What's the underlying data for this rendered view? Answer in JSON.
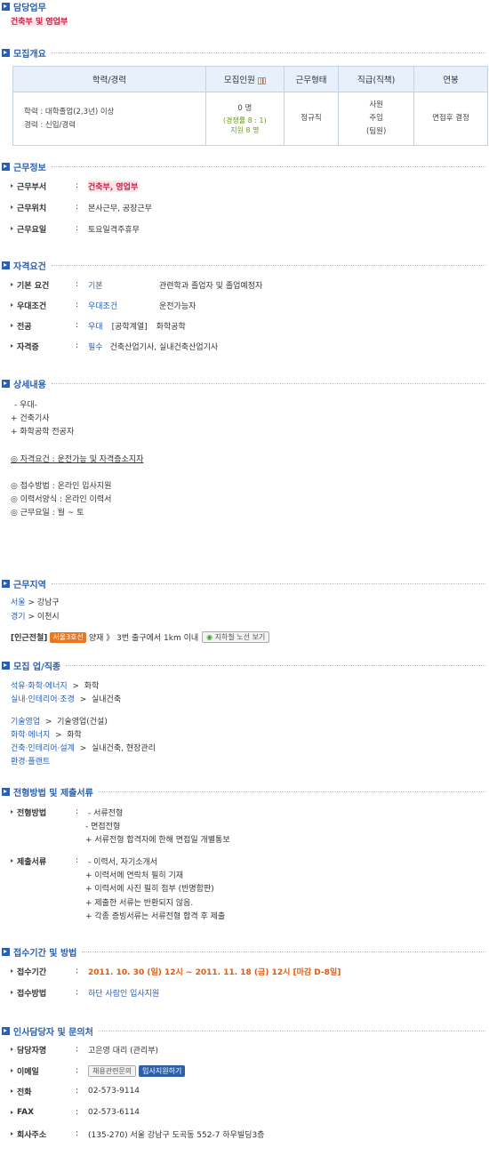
{
  "duty": {
    "title": "담당업무",
    "value": "건축부 및 영업부"
  },
  "overview": {
    "title": "모집개요",
    "headers": [
      "학력/경력",
      "모집인원",
      "근무형태",
      "직급(직책)",
      "연봉"
    ],
    "education": "학력 : 대학졸업(2,3년) 이상",
    "career": "경력 : 신입/경력",
    "headcount": "0 명",
    "competition": "(경쟁률 8 : 1)",
    "applicants": "지원 8 명",
    "work_type": "정규직",
    "rank_1": "사원",
    "rank_2": "주임",
    "rank_3": "(팀원)",
    "salary": "면접후 결정"
  },
  "work_info": {
    "title": "근무정보",
    "dept_label": "근무부서",
    "dept_value": "건축부, 영업부",
    "location_label": "근무위치",
    "location_value": "본사근무, 공장근무",
    "days_label": "근무요일",
    "days_value": "토요일격주휴무"
  },
  "qualifications": {
    "title": "자격요건",
    "basic_label": "기본 요건",
    "basic_type": "기본",
    "basic_value": "관련학과 졸업자 및 졸업예정자",
    "pref_label": "우대조건",
    "pref_type": "우대조건",
    "pref_value": "운전가능자",
    "major_label": "전공",
    "major_type": "우대",
    "major_field": "[공학계열]",
    "major_value": "화학공학",
    "cert_label": "자격증",
    "cert_type": "필수",
    "cert_value": "건축산업기사, 실내건축산업기사"
  },
  "details": {
    "title": "상세내용",
    "lines": [
      "- 우대-",
      "+ 건축기사",
      "+ 화학공학 전공자"
    ],
    "qual": "◎ 자격요건 : 운전가능 및 자격증소지자",
    "method": "◎ 접수방법 : 온라인 입사지원",
    "resume": "◎ 이력서양식 : 온라인 이력서",
    "days": "◎ 근무요일 : 월 ~ 토"
  },
  "region": {
    "title": "근무지역",
    "r1_city": "서울",
    "r1_sep": ">",
    "r1_dist": "강남구",
    "r2_city": "경기",
    "r2_sep": ">",
    "r2_dist": "이천시",
    "subway_label": "[인근전철]",
    "subway_line": "서울3호선",
    "subway_text": "양재 》 3번 출구에서 1km 이내",
    "subway_btn": "지하철 노선 보기"
  },
  "jobs": {
    "title": "모집 업/직종",
    "a1_cat": "석유·화학·에너지",
    "a1_sub": "화학",
    "a2_cat": "실내·인테리어·조경",
    "a2_sub": "실내건축",
    "b1_cat": "기술영업",
    "b1_sub": "기술영업(건설)",
    "b2_cat": "화학·에너지",
    "b2_sub": "화학",
    "b3_cat": "건축·인테리어·설계",
    "b3_sub": "실내건축, 현장관리",
    "b4_cat": "환경·플랜트",
    "sep": ">"
  },
  "process": {
    "title": "전형방법 및 제출서류",
    "method_label": "전형방법",
    "method_lines": [
      "- 서류전형",
      "- 면접전형",
      "+ 서류전형 합격자에 한해 면접일 개별통보"
    ],
    "docs_label": "제출서류",
    "docs_lines": [
      "- 이력서, 자기소개서",
      "+ 이력서에 연락처 필히 기재",
      "+ 이력서에 사진 필히 첨부 (반명함판)",
      "+ 제출한 서류는 반환되지 않음.",
      "+ 각종 증빙서류는 서류전형 합격 후 제출"
    ]
  },
  "period": {
    "title": "접수기간 및 방법",
    "period_label": "접수기간",
    "period_value": "2011. 10. 30 (일) 12시 ~ 2011. 11. 18 (금) 12시 [마감 D-8일]",
    "method_label": "접수방법",
    "method_value": "하단 사람인 입사지원"
  },
  "contact": {
    "title": "인사담당자 및 문의처",
    "name_label": "담당자명",
    "name_value": "고은영 대리 (관리부)",
    "email_label": "이메일",
    "email_btn1": "채용관련문의",
    "email_btn2": "입사지원하기",
    "phone_label": "전화",
    "phone_value": "02-573-9114",
    "fax_label": "FAX",
    "fax_value": "02-573-6114",
    "addr_label": "회사주소",
    "addr_value": "(135-270) 서울 강남구 도곡동 552-7 하우빌딩3층"
  },
  "colors": {
    "section_blue": "#2a5fb0",
    "highlight_red": "#cc2244",
    "deadline_orange": "#e05a10",
    "subway_orange": "#e87722"
  },
  "icons": [
    "section-arrow-icon",
    "bullet-arrow-icon",
    "chart-icon",
    "subway-icon"
  ]
}
